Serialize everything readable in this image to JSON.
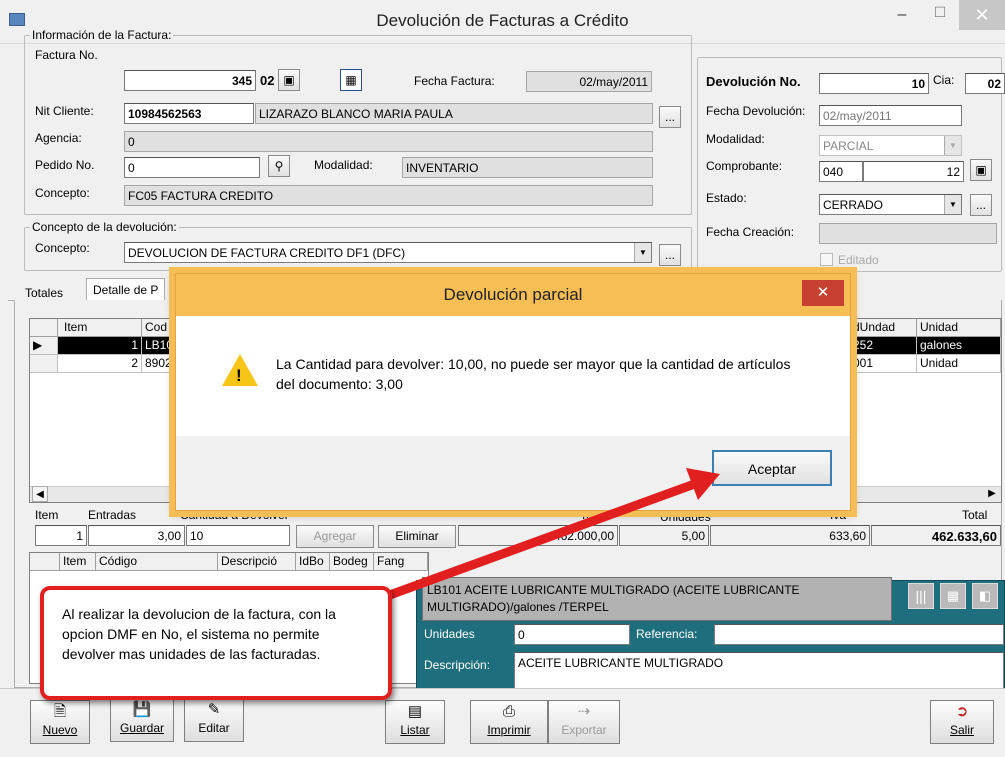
{
  "window": {
    "title": "Devolución de Facturas a Crédito",
    "minimize": "–",
    "maximize": "☐",
    "close": "✕"
  },
  "invoice_info": {
    "group_label": "Información de la Factura:",
    "factura_no_label": "Factura No.",
    "factura_no": "345",
    "factura_serie": "02",
    "fecha_factura_label": "Fecha Factura:",
    "fecha_factura": "02/may/2011",
    "nit_label": "Nit Cliente:",
    "nit": "10984562563",
    "cliente": "LIZARAZO BLANCO MARIA PAULA",
    "agencia_label": "Agencia:",
    "agencia": "0",
    "pedido_label": "Pedido No.",
    "pedido": "0",
    "modalidad_label": "Modalidad:",
    "modalidad": "INVENTARIO",
    "concepto_label": "Concepto:",
    "concepto": "FC05 FACTURA CREDITO",
    "ellipsis": "..."
  },
  "return_concept": {
    "group_label": "Concepto de la devolución:",
    "concepto_label": "Concepto:",
    "concepto": "DEVOLUCION DE FACTURA CREDITO DF1  (DFC)"
  },
  "return_info": {
    "devolucion_label": "Devolución No.",
    "devolucion_no": "10",
    "cia_label": "Cia:",
    "cia": "02",
    "fecha_devolucion_label": "Fecha Devolución:",
    "fecha_devolucion": "02/may/2011",
    "modalidad_label": "Modalidad:",
    "modalidad": "PARCIAL",
    "comprobante_label": "Comprobante:",
    "comprobante_code": "040",
    "comprobante_no": "12",
    "estado_label": "Estado:",
    "estado": "CERRADO",
    "fecha_creacion_label": "Fecha Creación:",
    "fecha_creacion": "",
    "editado_label": "Editado"
  },
  "tabs": [
    "Totales",
    "Detalle de P"
  ],
  "grid": {
    "headers": [
      "Item",
      "Cod",
      "dUndad",
      "Unidad"
    ],
    "rows": [
      {
        "item": "1",
        "code": "LB10",
        "cod_und": "252",
        "unidad": "galones"
      },
      {
        "item": "2",
        "code": "8902",
        "cod_und": "001",
        "unidad": "Unidad"
      }
    ]
  },
  "entry": {
    "item_label": "Item",
    "entradas_label": "Entradas",
    "cantidad_label": "Cantidad a Devolver",
    "total_col_label": "Total",
    "unidades_label": "Unidades",
    "iva_label": "Iva",
    "total_label": "Total",
    "item": "1",
    "entradas": "3,00",
    "cantidad": "10",
    "agregar": "Agregar",
    "eliminar": "Eliminar",
    "subtotal": "462.000,00",
    "unidades": "5,00",
    "iva": "633,60",
    "total": "462.633,60"
  },
  "detail_grid": {
    "headers": [
      "Item",
      "Código",
      "Descripció",
      "IdBo",
      "Bodeg",
      "Fang"
    ]
  },
  "dialog": {
    "title": "Devolución parcial",
    "message": "La Cantidad para devolver: 10,00, no puede ser mayor que la cantidad de artículos del documento: 3,00",
    "ok": "Aceptar",
    "close": "✕"
  },
  "product_panel": {
    "description": "LB101 ACEITE LUBRICANTE MULTIGRADO (ACEITE LUBRICANTE MULTIGRADO)/galones /TERPEL",
    "unidades_label": "Unidades",
    "unidades": "0",
    "referencia_label": "Referencia:",
    "referencia": "",
    "descripcion_label": "Descripción:",
    "descripcion": "ACEITE LUBRICANTE MULTIGRADO"
  },
  "callout": {
    "text": "Al realizar la devolucion de la factura, con la opcion DMF en No, el sistema no permite devolver mas unidades de las facturadas."
  },
  "toolbar": {
    "nuevo": "Nuevo",
    "guardar": "Guardar",
    "editar": "Editar",
    "listar": "Listar",
    "imprimir": "Imprimir",
    "exportar": "Exportar",
    "salir": "Salir"
  }
}
